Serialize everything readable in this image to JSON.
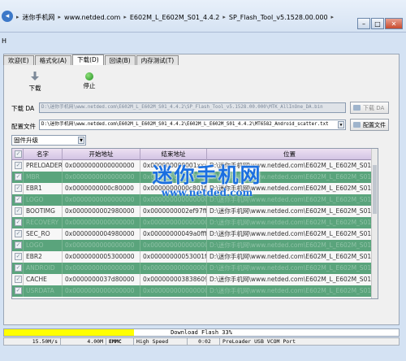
{
  "breadcrumb": {
    "items": [
      "迷你手机网",
      "www.netded.com",
      "E602M_L_E602M_S01_4.4.2",
      "SP_Flash_Tool_v5.1528.00.000"
    ]
  },
  "toolbar_letter": "H",
  "tabs": [
    {
      "label": "欢迎(E)",
      "active": false
    },
    {
      "label": "格式化(A)",
      "active": false
    },
    {
      "label": "下载(D)",
      "active": true
    },
    {
      "label": "回读(B)",
      "active": false
    },
    {
      "label": "内存测试(T)",
      "active": false
    }
  ],
  "actions": {
    "download_label": "下载",
    "stop_label": "停止"
  },
  "da": {
    "label": "下载 DA",
    "path": "D:\\迷你手机网\\www.netded.com\\E602M_L_E602M_S01_4.4.2\\SP_Flash_Tool_v5.1528.00.000\\MTK_AllInOne_DA.bin",
    "button": "下载 DA"
  },
  "scatter": {
    "label": "配置文件",
    "path": "D:\\迷你手机网\\www.netded.com\\E602M_L_E602M_S01_4.4.2\\E602M_L_E602M_S01_4.4.2\\MT6582_Android_scatter.txt",
    "button": "配置文件"
  },
  "mode_select": "固件升级",
  "table": {
    "columns": [
      "名字",
      "开始地址",
      "结束地址",
      "位置"
    ],
    "rows": [
      {
        "name": "PRELOADER",
        "start": "0x0000000000000000",
        "end": "0x000000000001xxxx",
        "location": "D:\\迷你手机网\\www.netded.com\\E602M_L_E602M_S01_4.4.2\\",
        "style": "white"
      },
      {
        "name": "MBR",
        "start": "0x0000000000000000",
        "end": "0x0000000000000000",
        "location": "D:\\迷你手机网\\www.netded.com\\E602M_L_E602M_S01_4.4.2\\",
        "style": "green"
      },
      {
        "name": "EBR1",
        "start": "0x0000000000c80000",
        "end": "0x0000000000c801ff",
        "location": "D:\\迷你手机网\\www.netded.com\\E602M_L_E602M_S01_4.4.2\\",
        "style": "white"
      },
      {
        "name": "LOGO",
        "start": "0x0000000000000000",
        "end": "0x0000000000000000",
        "location": "D:\\迷你手机网\\www.netded.com\\E602M_L_E602M_S01_4.4.2\\",
        "style": "green"
      },
      {
        "name": "BOOTIMG",
        "start": "0x0000000002980000",
        "end": "0x0000000002ef97ff",
        "location": "D:\\迷你手机网\\www.netded.com\\E602M_L_E602M_S01_4.4.2\\",
        "style": "white"
      },
      {
        "name": "RECOVERY",
        "start": "0x0000000000000000",
        "end": "0x0000000000000000",
        "location": "D:\\迷你手机网\\www.netded.com\\E602M_L_E602M_S01_4.4.2\\",
        "style": "green"
      },
      {
        "name": "SEC_RO",
        "start": "0x0000000004980000",
        "end": "0x00000000049a0fff",
        "location": "D:\\迷你手机网\\www.netded.com\\E602M_L_E602M_S01_4.4.2\\",
        "style": "white"
      },
      {
        "name": "LOGO",
        "start": "0x0000000000000000",
        "end": "0x0000000000000000",
        "location": "D:\\迷你手机网\\www.netded.com\\E602M_L_E602M_S01_4.4.2\\",
        "style": "green"
      },
      {
        "name": "EBR2",
        "start": "0x0000000005300000",
        "end": "0x00000000053001ff",
        "location": "D:\\迷你手机网\\www.netded.com\\E602M_L_E602M_S01_4.4.2\\",
        "style": "white"
      },
      {
        "name": "ANDROID",
        "start": "0x0000000000000000",
        "end": "0x0000000000000000",
        "location": "D:\\迷你手机网\\www.netded.com\\E602M_L_E602M_S01_4.4.2\\",
        "style": "green"
      },
      {
        "name": "CACHE",
        "start": "0x0000000037d80000",
        "end": "0x0000000038386093",
        "location": "D:\\迷你手机网\\www.netded.com\\E602M_L_E602M_S01_4.4.2\\",
        "style": "white"
      },
      {
        "name": "USRDATA",
        "start": "0x0000000000000000",
        "end": "0x0000000000000000",
        "location": "D:\\迷你手机网\\www.netded.com\\E602M_L_E602M_S01_4.4.2\\",
        "style": "green"
      }
    ]
  },
  "watermark": {
    "title": "迷你手机网",
    "url": "www.netded.com"
  },
  "progress": {
    "text": "Download Flash 33%",
    "percent": 33,
    "color": "#ffff00"
  },
  "status": {
    "speed": "15.50M/s",
    "size": "4.00M",
    "storage": "EMMC",
    "mode": "High Speed",
    "time": "0:02",
    "port": "PreLoader USB VCOM Port"
  }
}
